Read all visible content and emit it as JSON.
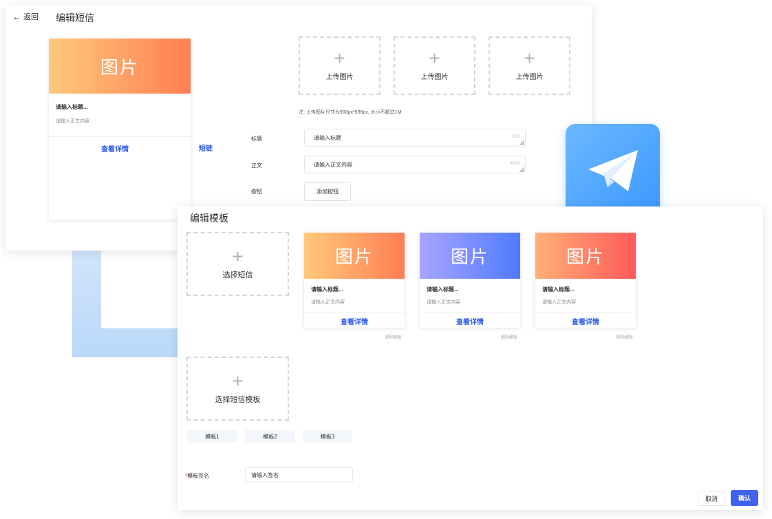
{
  "edit_sms": {
    "back_label": "返回",
    "title": "编辑短信",
    "preview_card": {
      "image_text": "图片",
      "title": "请输入标题...",
      "body": "请输入正文内容",
      "link": "查看详情"
    },
    "upload_label": "上传图片",
    "upload_note": "注: 上传图片尺寸为900px*596px, 大小不超过1M",
    "short_link_label": "短链",
    "title_label": "标题",
    "title_input": "请输入标题",
    "title_counter": "0/12",
    "body_label": "正文",
    "body_input": "请输入正文内容",
    "body_counter": "0/500",
    "button_label": "按钮",
    "add_button": "添加按钮"
  },
  "edit_template": {
    "title": "编辑模板",
    "select_sms": "选择短信",
    "select_template": "选择短信模板",
    "cards": [
      {
        "image_text": "图片",
        "title": "请输入标题...",
        "body": "请输入正文内容",
        "link": "查看详情",
        "delete": "删除模板",
        "gradient": "orange"
      },
      {
        "image_text": "图片",
        "title": "请输入标题...",
        "body": "请输入正文内容",
        "link": "查看详情",
        "delete": "删除模板",
        "gradient": "blue"
      },
      {
        "image_text": "图片",
        "title": "请输入标题...",
        "body": "请输入正文内容",
        "link": "查看详情",
        "delete": "删除模板",
        "gradient": "red"
      }
    ],
    "tabs": [
      "模板1",
      "模板2",
      "模板3"
    ],
    "signature_required_mark": "*",
    "signature_label": "模板签名",
    "signature_input": "请输入签名",
    "cancel_button": "取消",
    "confirm_button": "确认"
  },
  "colors": {
    "accent": "#3f63ee",
    "link": "#2f5bea",
    "telegram_blue": "#3b98ff"
  },
  "icons": {
    "back": "arrow-left-icon",
    "upload": "plus-icon",
    "app": "telegram-plane-icon"
  }
}
